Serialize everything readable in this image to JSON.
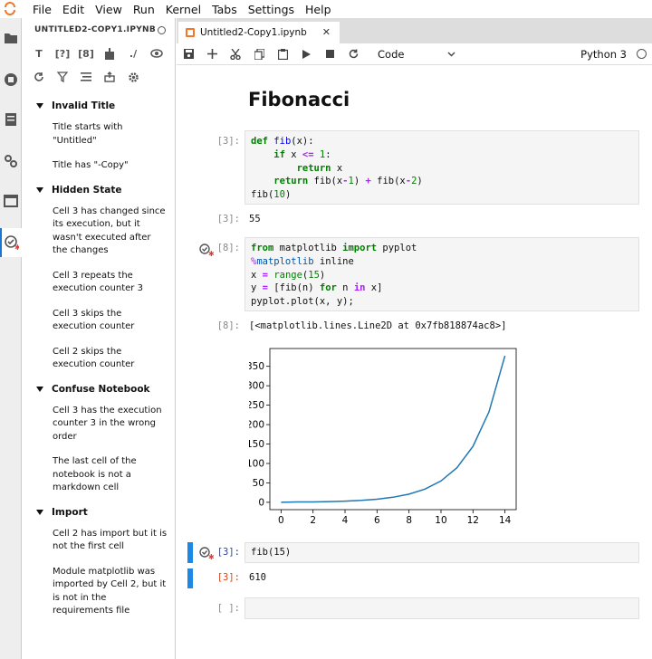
{
  "menubar": {
    "items": [
      "File",
      "Edit",
      "View",
      "Run",
      "Kernel",
      "Tabs",
      "Settings",
      "Help"
    ]
  },
  "panel": {
    "title": "UNTITLED2-COPY1.IPYNB",
    "toolbar_row1": [
      "T",
      "[?]",
      "[8]",
      "",
      "./",
      ""
    ],
    "sections": [
      {
        "title": "Invalid Title",
        "issues": [
          "Title starts with \"Untitled\"",
          "Title has \"-Copy\""
        ]
      },
      {
        "title": "Hidden State",
        "issues": [
          "Cell 3 has changed since its execution, but it wasn't executed after the changes",
          "Cell 3 repeats the execution counter 3",
          "Cell 3 skips the execution counter",
          "Cell 2 skips the execution counter"
        ]
      },
      {
        "title": "Confuse Notebook",
        "issues": [
          "Cell 3 has the execution counter 3 in the wrong order",
          "The last cell of the notebook is not a markdown cell"
        ]
      },
      {
        "title": "Import",
        "issues": [
          "Cell 2 has import but it is not the first cell",
          "Module matplotlib was imported by Cell 2, but it is not in the requirements file"
        ]
      }
    ]
  },
  "tab": {
    "label": "Untitled2-Copy1.ipynb",
    "close": "✕"
  },
  "nbtoolbar": {
    "cell_type": "Code",
    "kernel": "Python 3"
  },
  "notebook": {
    "title": "Fibonacci",
    "cells": [
      {
        "prompt": "[3]:",
        "out_prompt": "[3]:",
        "output": "55"
      },
      {
        "prompt": "[8]:",
        "out_prompt": "[8]:",
        "output": "[<matplotlib.lines.Line2D at 0x7fb818874ac8>]"
      },
      {
        "prompt": "[3]:",
        "code": "fib(15)",
        "out_prompt": "[3]:",
        "output": "610"
      },
      {
        "prompt": "[ ]:"
      }
    ]
  },
  "chart_data": {
    "type": "line",
    "x": [
      0,
      1,
      2,
      3,
      4,
      5,
      6,
      7,
      8,
      9,
      10,
      11,
      12,
      13,
      14
    ],
    "series": [
      {
        "values": [
          0,
          1,
          1,
          2,
          3,
          5,
          8,
          13,
          21,
          34,
          55,
          89,
          144,
          233,
          377
        ],
        "color": "#1f77b4"
      }
    ],
    "xticks": [
      0,
      2,
      4,
      6,
      8,
      10,
      12,
      14
    ],
    "yticks": [
      0,
      50,
      100,
      150,
      200,
      250,
      300,
      350
    ],
    "xlim": [
      -0.7,
      14.7
    ],
    "ylim": [
      -18.85,
      395.85
    ],
    "title": "",
    "xlabel": "",
    "ylabel": "",
    "grid": false
  }
}
